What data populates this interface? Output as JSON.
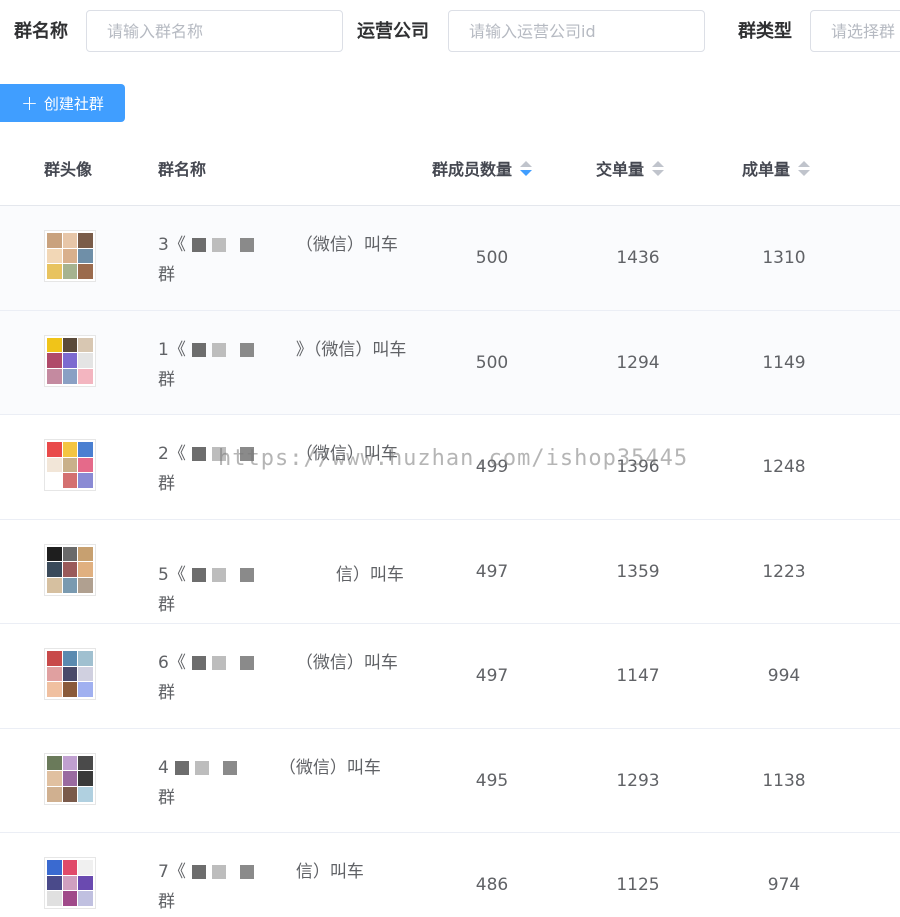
{
  "filters": {
    "group_name_label": "群名称",
    "group_name_placeholder": "请输入群名称",
    "company_label": "运营公司",
    "company_placeholder": "请输入运营公司id",
    "group_type_label": "群类型",
    "group_type_placeholder": "请选择群"
  },
  "create_button": {
    "label": "创建社群",
    "icon": "plus-icon"
  },
  "table": {
    "headers": {
      "avatar": "群头像",
      "name": "群名称",
      "members": "群成员数量",
      "submit": "交单量",
      "done": "成单量"
    },
    "sort_state": {
      "members": "descending"
    },
    "rows": [
      {
        "name_prefix": "3《",
        "name_suffix": "（微信）叫车",
        "name_line2": "群",
        "members": "500",
        "submit": "1436",
        "done": "1310"
      },
      {
        "name_prefix": "1《",
        "name_suffix": "》（微信）叫车",
        "name_line2": "群",
        "members": "500",
        "submit": "1294",
        "done": "1149"
      },
      {
        "name_prefix": "2《",
        "name_suffix": "（微信）叫车",
        "name_line2": "群",
        "members": "499",
        "submit": "1396",
        "done": "1248"
      },
      {
        "name_prefix": "5《",
        "name_suffix": "信）叫车群",
        "name_line2": "",
        "members": "497",
        "submit": "1359",
        "done": "1223"
      },
      {
        "name_prefix": "6《",
        "name_suffix": "（微信）叫车",
        "name_line2": "群",
        "members": "497",
        "submit": "1147",
        "done": "994"
      },
      {
        "name_prefix": "4",
        "name_suffix": "（微信）叫车",
        "name_line2": "群",
        "members": "495",
        "submit": "1293",
        "done": "1138"
      },
      {
        "name_prefix": "7《",
        "name_suffix": "信）叫车",
        "name_line2": "群",
        "members": "486",
        "submit": "1125",
        "done": "974"
      }
    ]
  },
  "watermark": "https://www.huzhan.com/ishop35445",
  "colors": {
    "primary": "#409eff",
    "border": "#dcdfe6",
    "text": "#606266",
    "header_text": "#454851"
  }
}
